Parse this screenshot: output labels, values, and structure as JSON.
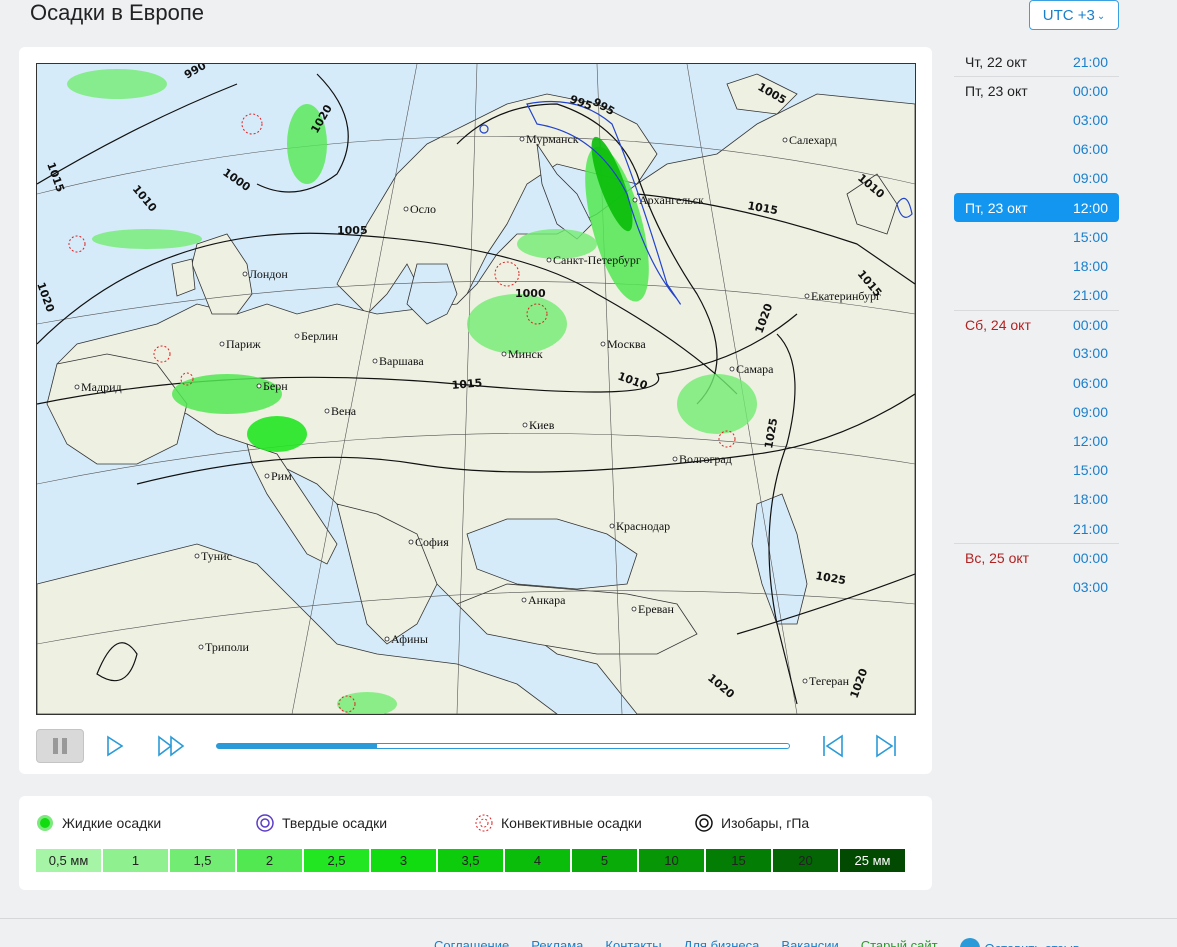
{
  "page": {
    "title": "Осадки в Европе"
  },
  "timezone": {
    "label": "UTC +3"
  },
  "map": {
    "cities": [
      {
        "name": "Осло"
      },
      {
        "name": "Лондон"
      },
      {
        "name": "Париж"
      },
      {
        "name": "Берлин"
      },
      {
        "name": "Варшава"
      },
      {
        "name": "Мадрид"
      },
      {
        "name": "Берн"
      },
      {
        "name": "Вена"
      },
      {
        "name": "Рим"
      },
      {
        "name": "Тунис"
      },
      {
        "name": "Триполи"
      },
      {
        "name": "София"
      },
      {
        "name": "Афины"
      },
      {
        "name": "Анкара"
      },
      {
        "name": "Ереван"
      },
      {
        "name": "Тегеран"
      },
      {
        "name": "Краснодар"
      },
      {
        "name": "Волгоград"
      },
      {
        "name": "Киев"
      },
      {
        "name": "Минск"
      },
      {
        "name": "Москва"
      },
      {
        "name": "Самара"
      },
      {
        "name": "Санкт-Петербург"
      },
      {
        "name": "Мурманск"
      },
      {
        "name": "Архангельск"
      },
      {
        "name": "Салехард"
      },
      {
        "name": "Екатеринбург"
      }
    ],
    "isobar_labels": [
      "995",
      "990",
      "1015",
      "1010",
      "1000",
      "1005",
      "1020",
      "995",
      "1005",
      "1015",
      "1010",
      "1000",
      "1015",
      "1020",
      "1010",
      "1015",
      "1020",
      "1025",
      "1025",
      "1020",
      "1020"
    ]
  },
  "player": {
    "progress_fraction": 0.28
  },
  "legend": {
    "items": [
      {
        "label": "Жидкие осадки",
        "icon": "liquid-precip-icon"
      },
      {
        "label": "Твердые осадки",
        "icon": "solid-precip-icon"
      },
      {
        "label": "Конвективные осадки",
        "icon": "convective-precip-icon"
      },
      {
        "label": "Изобары, гПа",
        "icon": "isobar-icon"
      }
    ],
    "scale": [
      {
        "label": "0,5 мм",
        "color": "#a6f5a6"
      },
      {
        "label": "1",
        "color": "#8ef08e"
      },
      {
        "label": "1,5",
        "color": "#72ec72"
      },
      {
        "label": "2",
        "color": "#52e852"
      },
      {
        "label": "2,5",
        "color": "#22e622"
      },
      {
        "label": "3",
        "color": "#10dc10"
      },
      {
        "label": "3,5",
        "color": "#0ccc0c"
      },
      {
        "label": "4",
        "color": "#0abd0a"
      },
      {
        "label": "5",
        "color": "#08ab08"
      },
      {
        "label": "10",
        "color": "#069606"
      },
      {
        "label": "15",
        "color": "#047d04"
      },
      {
        "label": "20",
        "color": "#036503"
      },
      {
        "label": "25 мм",
        "color": "#024a02"
      }
    ]
  },
  "times": [
    {
      "day": "Чт, 22 окт",
      "hour": "21:00",
      "divider": false,
      "weekend": false,
      "active": false
    },
    {
      "day": "Пт, 23 окт",
      "hour": "00:00",
      "divider": true,
      "weekend": false,
      "active": false
    },
    {
      "day": "",
      "hour": "03:00",
      "divider": false,
      "weekend": false,
      "active": false
    },
    {
      "day": "",
      "hour": "06:00",
      "divider": false,
      "weekend": false,
      "active": false
    },
    {
      "day": "",
      "hour": "09:00",
      "divider": false,
      "weekend": false,
      "active": false
    },
    {
      "day": "Пт, 23 окт",
      "hour": "12:00",
      "divider": false,
      "weekend": false,
      "active": true
    },
    {
      "day": "",
      "hour": "15:00",
      "divider": false,
      "weekend": false,
      "active": false
    },
    {
      "day": "",
      "hour": "18:00",
      "divider": false,
      "weekend": false,
      "active": false
    },
    {
      "day": "",
      "hour": "21:00",
      "divider": false,
      "weekend": false,
      "active": false
    },
    {
      "day": "Сб, 24 окт",
      "hour": "00:00",
      "divider": true,
      "weekend": true,
      "active": false
    },
    {
      "day": "",
      "hour": "03:00",
      "divider": false,
      "weekend": false,
      "active": false
    },
    {
      "day": "",
      "hour": "06:00",
      "divider": false,
      "weekend": false,
      "active": false
    },
    {
      "day": "",
      "hour": "09:00",
      "divider": false,
      "weekend": false,
      "active": false
    },
    {
      "day": "",
      "hour": "12:00",
      "divider": false,
      "weekend": false,
      "active": false
    },
    {
      "day": "",
      "hour": "15:00",
      "divider": false,
      "weekend": false,
      "active": false
    },
    {
      "day": "",
      "hour": "18:00",
      "divider": false,
      "weekend": false,
      "active": false
    },
    {
      "day": "",
      "hour": "21:00",
      "divider": false,
      "weekend": false,
      "active": false
    },
    {
      "day": "Вс, 25 окт",
      "hour": "00:00",
      "divider": true,
      "weekend": true,
      "active": false
    },
    {
      "day": "",
      "hour": "03:00",
      "divider": false,
      "weekend": false,
      "active": false
    }
  ],
  "footer": {
    "links": [
      {
        "label": "Соглашение",
        "style": "blue"
      },
      {
        "label": "Реклама",
        "style": "blue"
      },
      {
        "label": "Контакты",
        "style": "blue"
      },
      {
        "label": "Для бизнеса",
        "style": "blue"
      },
      {
        "label": "Вакансии",
        "style": "blue"
      },
      {
        "label": "Старый сайт",
        "style": "green"
      }
    ],
    "feedback_label": "Оставить отзыв"
  }
}
